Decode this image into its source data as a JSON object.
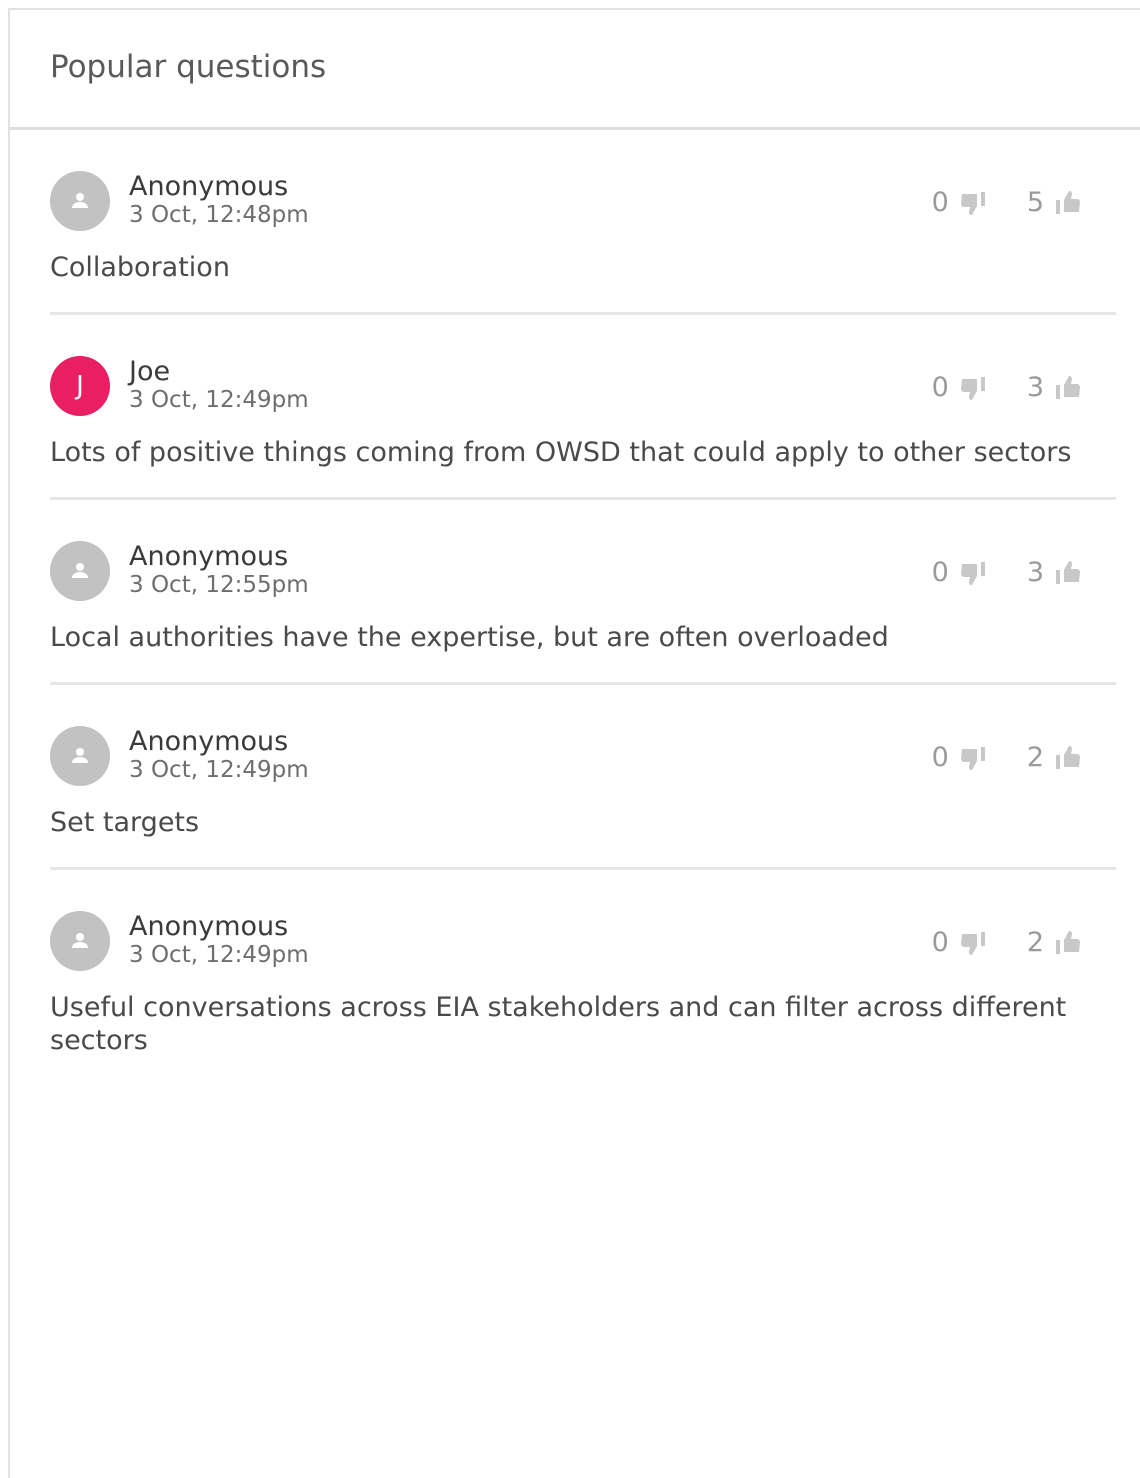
{
  "panel": {
    "title": "Popular questions"
  },
  "questions": [
    {
      "author": "Anonymous",
      "avatar_initial": "",
      "time": "3 Oct, 12:48pm",
      "text": "Collaboration",
      "downvotes": "0",
      "upvotes": "5"
    },
    {
      "author": "Joe",
      "avatar_initial": "J",
      "time": "3 Oct, 12:49pm",
      "text": "Lots of positive things coming from OWSD that could apply to other sectors",
      "downvotes": "0",
      "upvotes": "3"
    },
    {
      "author": "Anonymous",
      "avatar_initial": "",
      "time": "3 Oct, 12:55pm",
      "text": "Local authorities have the expertise, but are often overloaded",
      "downvotes": "0",
      "upvotes": "3"
    },
    {
      "author": "Anonymous",
      "avatar_initial": "",
      "time": "3 Oct, 12:49pm",
      "text": "Set targets",
      "downvotes": "0",
      "upvotes": "2"
    },
    {
      "author": "Anonymous",
      "avatar_initial": "",
      "time": "3 Oct, 12:49pm",
      "text": "Useful conversations across EIA stakeholders and can filter across different sectors",
      "downvotes": "0",
      "upvotes": "2"
    }
  ],
  "colors": {
    "avatar_default": "#c2c2c2",
    "avatar_initial": "#e91e63",
    "vote_icon": "#c8c8c8"
  },
  "icons": {
    "avatar_default": "user-icon",
    "downvote": "thumbs-down-icon",
    "upvote": "thumbs-up-icon"
  }
}
